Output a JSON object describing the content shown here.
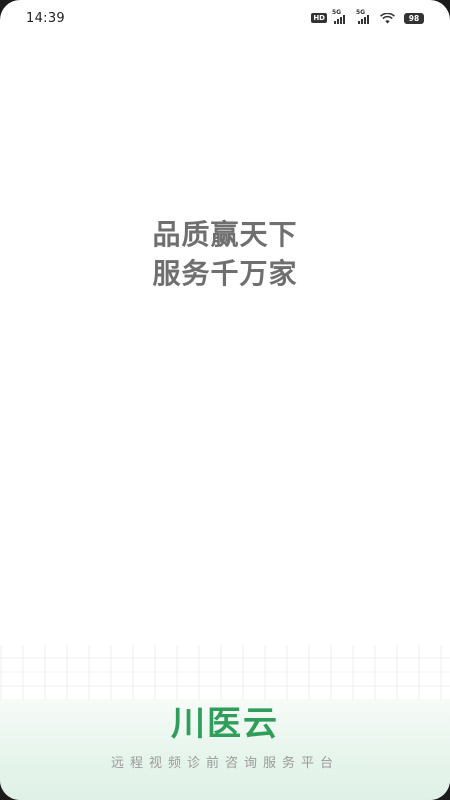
{
  "status_bar": {
    "time": "14:39",
    "hd_label": "HD",
    "network_1": "5G",
    "network_2": "5G",
    "battery": "98",
    "icons": [
      "hd-icon",
      "signal-icon",
      "signal-icon",
      "wifi-icon",
      "battery-icon"
    ]
  },
  "splash": {
    "slogan_line1": "品质赢天下",
    "slogan_line2": "服务千万家"
  },
  "brand": {
    "logo_text": "川医云",
    "tagline": "远程视频诊前咨询服务平台",
    "color": "#2f9e5b"
  }
}
